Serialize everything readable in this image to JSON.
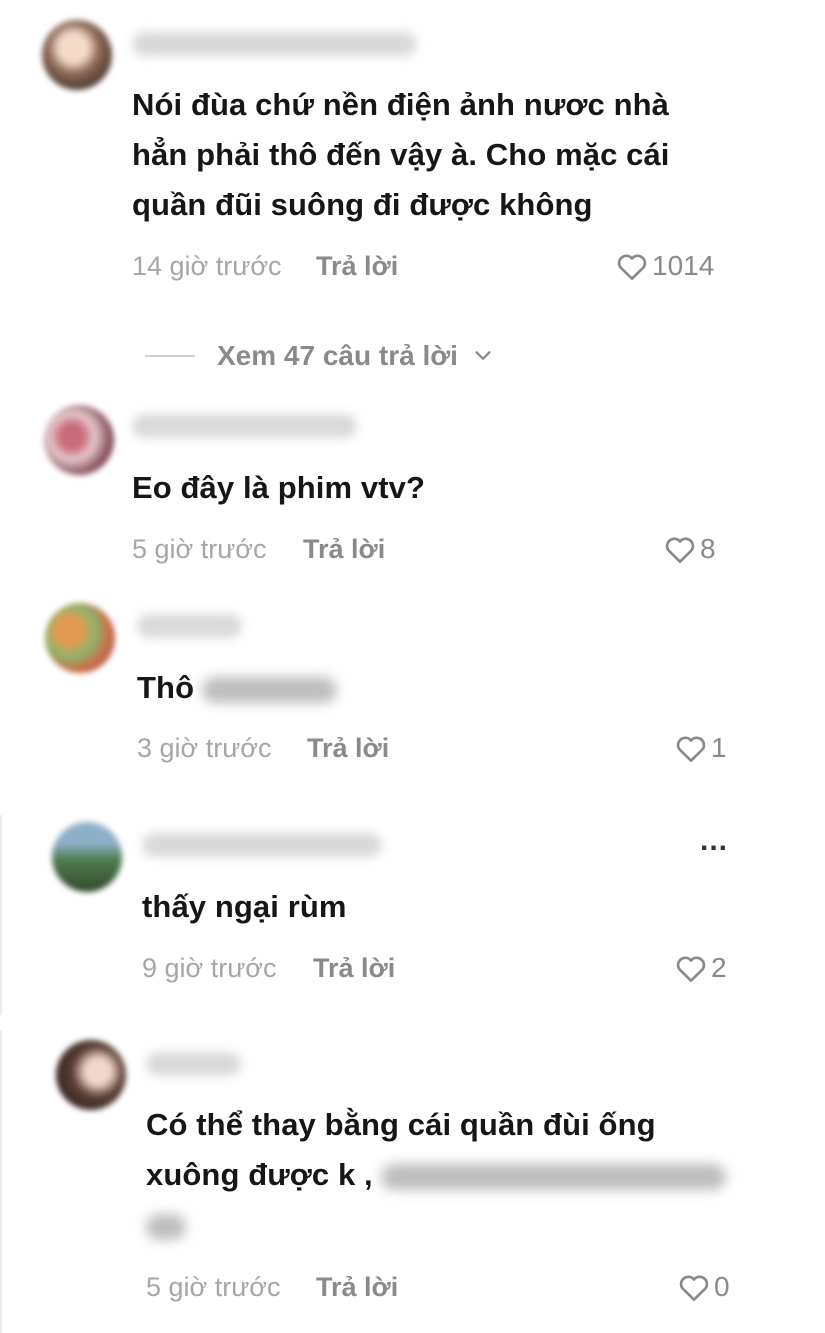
{
  "comments": [
    {
      "text": "Nói đùa chứ nền điện ảnh nươc nhà hẳn phải thô đến vậy à. Cho mặc cái quần đũi suông đi được không",
      "time": "14 giờ trước",
      "reply_label": "Trả lời",
      "likes": "1014"
    },
    {
      "text": "Eo đây là phim vtv?",
      "time": "5 giờ trước",
      "reply_label": "Trả lời",
      "likes": "8"
    },
    {
      "text": "Thô",
      "time": "3 giờ trước",
      "reply_label": "Trả lời",
      "likes": "1"
    },
    {
      "text": "thấy ngại rùm",
      "time": "9 giờ trước",
      "reply_label": "Trả lời",
      "likes": "2"
    },
    {
      "text_line1": "Có thể thay bằng cái quần đùi ống",
      "text_line2": "xuông được k ,",
      "time": "5 giờ trước",
      "reply_label": "Trả lời",
      "likes": "0"
    }
  ],
  "view_replies": "Xem 47 câu trả lời",
  "more_menu": "...",
  "icons": {
    "like": "heart-outline-icon",
    "expand": "chevron-down-icon",
    "menu": "more-horizontal-icon"
  },
  "colors": {
    "text": "#161616",
    "secondary": "#a6a6a6",
    "reply": "#8a8a8a"
  }
}
